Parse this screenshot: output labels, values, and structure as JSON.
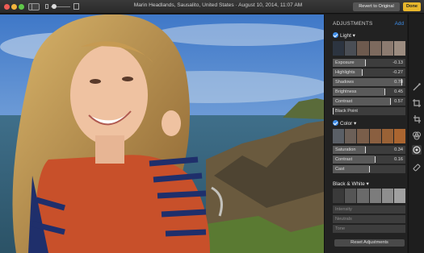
{
  "titlebar": {
    "title": "Marin Headlands, Sausalito, United States  ·  August 10, 2014, 11:07 AM",
    "revert_label": "Revert to Original",
    "done_label": "Done",
    "zoom_level": 0.15
  },
  "panel": {
    "title": "ADJUSTMENTS",
    "add_label": "Add",
    "light": {
      "label": "Light",
      "rows": [
        {
          "label": "Exposure",
          "value": "-0.13",
          "level": 0.45
        },
        {
          "label": "Highlights",
          "value": "-0.27",
          "level": 0.4
        },
        {
          "label": "Shadows",
          "value": "0.78",
          "level": 0.95
        },
        {
          "label": "Brightness",
          "value": "0.45",
          "level": 0.72
        },
        {
          "label": "Contrast",
          "value": "0.57",
          "level": 0.8
        },
        {
          "label": "Black Point",
          "value": "",
          "level": 0.0
        }
      ]
    },
    "color": {
      "label": "Color",
      "rows": [
        {
          "label": "Saturation",
          "value": "0.34",
          "level": 0.45
        },
        {
          "label": "Contrast",
          "value": "0.16",
          "level": 0.58
        },
        {
          "label": "Cast",
          "value": "",
          "level": 0.5
        }
      ]
    },
    "bw": {
      "label": "Black & White",
      "rows": [
        {
          "label": "Intensity",
          "value": ""
        },
        {
          "label": "Neutrals",
          "value": ""
        },
        {
          "label": "Tone",
          "value": ""
        }
      ]
    },
    "reset_label": "Reset Adjustments"
  },
  "tools": [
    "magic-wand-icon",
    "crop-icon",
    "rotate-icon",
    "filters-icon",
    "adjust-icon",
    "retouch-icon"
  ],
  "colors": {
    "accent": "#3e8de8",
    "done": "#e7b62c"
  }
}
